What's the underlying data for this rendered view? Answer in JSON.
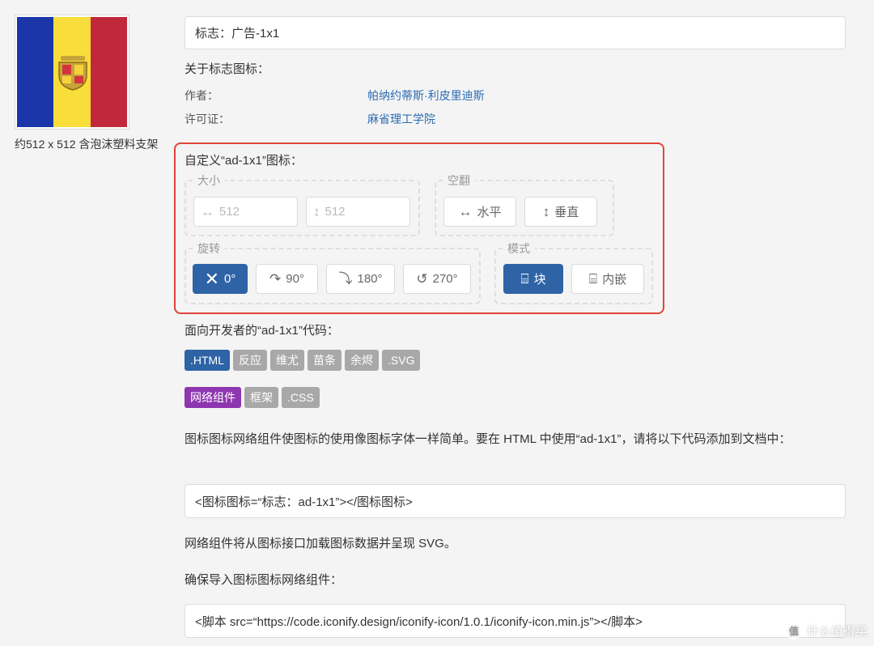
{
  "preview": {
    "flag_colors": [
      "#1a36a8",
      "#f9dd3a",
      "#c1283c"
    ],
    "size_caption": "约512 x 512 含泡沫塑料支架"
  },
  "icon_name_field": "标志：广告-1x1",
  "about": {
    "heading": "关于标志图标：",
    "author_label": "作者：",
    "author_value": "帕纳约蒂斯·利皮里迪斯",
    "license_label": "许可证：",
    "license_value": "麻省理工学院"
  },
  "customize": {
    "heading": "自定义“ad-1x1”图标：",
    "size": {
      "legend": "大小",
      "width_placeholder": "512",
      "height_placeholder": "512"
    },
    "flip": {
      "legend": "空翻",
      "horizontal": "水平",
      "vertical": "垂直"
    },
    "rotate": {
      "legend": "旋转",
      "options": [
        "0°",
        "90°",
        "180°",
        "270°"
      ],
      "selected": "0°"
    },
    "mode": {
      "legend": "模式",
      "block": "块",
      "inline": "内嵌",
      "selected": "块"
    }
  },
  "developer": {
    "heading": "面向开发者的“ad-1x1”代码：",
    "tabs_row1": [
      ".HTML",
      "反应",
      "维尤",
      "苗条",
      "余烬",
      ".SVG"
    ],
    "tabs_row2": [
      "网络组件",
      "框架",
      ".CSS"
    ],
    "active_tab": ".HTML",
    "active_subtab": "网络组件",
    "description": "图标图标网络组件使图标的使用像图标字体一样简单。要在 HTML 中使用“ad-1x1”，请将以下代码添加到文档中：",
    "code_snippet": "<图标图标=“标志：ad-1x1”></图标图标>",
    "note": "网络组件将从图标接口加载图标数据并呈现 SVG。",
    "import_heading": "确保导入图标图标网络组件：",
    "import_snippet": "<脚本 src=“https://code.iconify.design/iconify-icon/1.0.1/iconify-icon.min.js”></脚本>"
  },
  "watermark": {
    "badge": "值",
    "text": "什么值得买"
  }
}
